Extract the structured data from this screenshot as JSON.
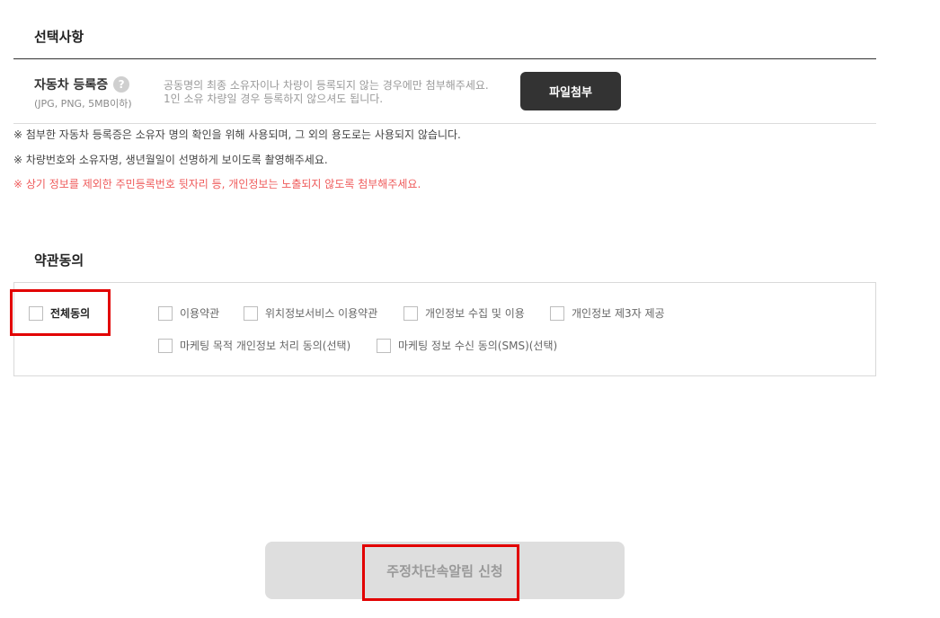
{
  "optional_section": {
    "title": "선택사항",
    "registration": {
      "label": "자동차 등록증",
      "help_icon": "?",
      "formats": "(JPG, PNG, 5MB이하)",
      "desc_line1": "공동명의 최종 소유자이나 차량이 등록되지 않는 경우에만 첨부해주세요.",
      "desc_line2": "1인 소유 차량일 경우 등록하지 않으셔도 됩니다.",
      "upload_button": "파일첨부"
    },
    "notices": [
      "※ 첨부한 자동차 등록증은 소유자 명의 확인을 위해 사용되며, 그 외의 용도로는 사용되지 않습니다.",
      "※ 차량번호와 소유자명, 생년월일이 선명하게 보이도록 촬영해주세요.",
      "※ 상기 정보를 제외한 주민등록번호 뒷자리 등, 개인정보는 노출되지 않도록 첨부해주세요."
    ]
  },
  "terms_section": {
    "title": "약관동의",
    "all_agree": "전체동의",
    "terms": [
      "이용약관",
      "위치정보서비스 이용약관",
      "개인정보 수집 및 이용",
      "개인정보 제3자 제공",
      "마케팅 목적 개인정보 처리 동의(선택)",
      "마케팅 정보 수신 동의(SMS)(선택)"
    ]
  },
  "submit_button": "주정차단속알림 신청",
  "colors": {
    "highlight": "#e20000",
    "notice_red": "#ef5b5b",
    "upload_button_bg": "#333333",
    "submit_bg": "#dedede"
  }
}
